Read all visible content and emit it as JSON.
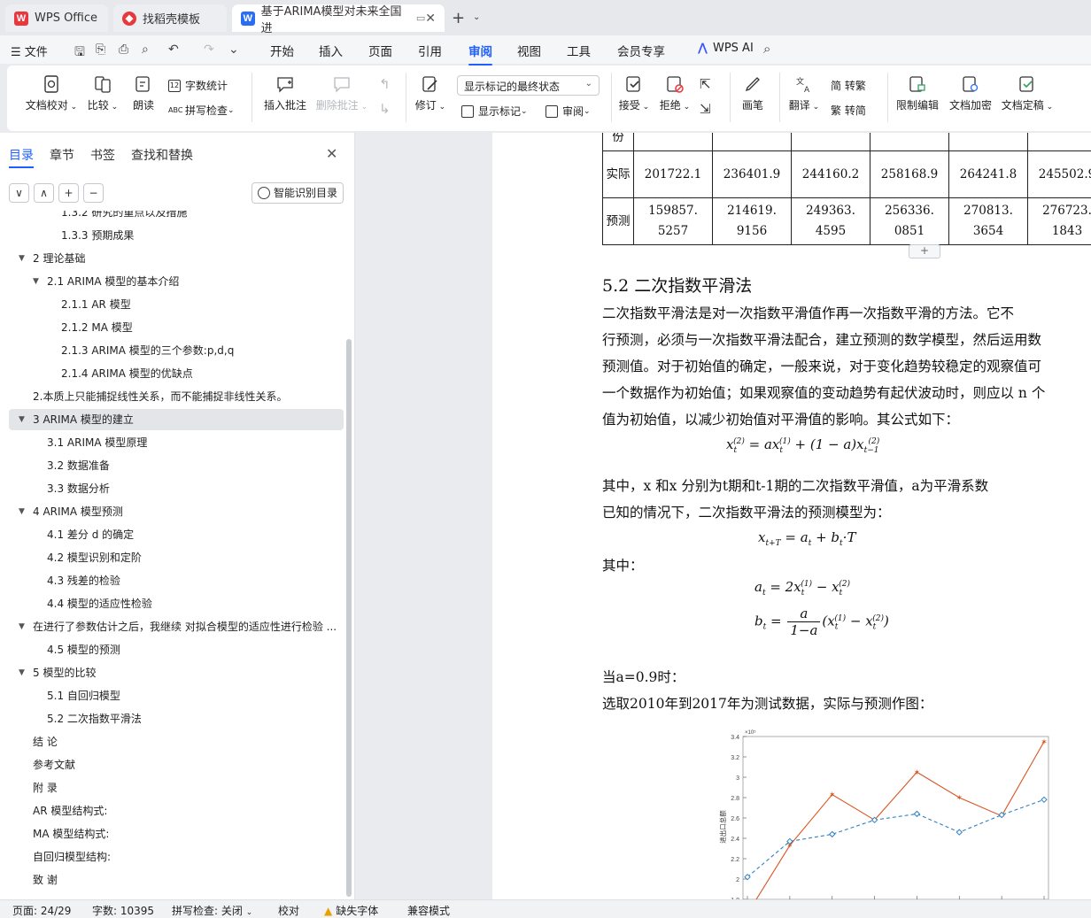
{
  "tabs": {
    "wps_office": "WPS Office",
    "templates": "找稻壳模板",
    "document": "基于ARIMA模型对未来全国进"
  },
  "menubar": {
    "file": "文件",
    "tabs": [
      "开始",
      "插入",
      "页面",
      "引用",
      "审阅",
      "视图",
      "工具",
      "会员专享"
    ],
    "active_tab": "审阅",
    "wps_ai": "WPS AI"
  },
  "ribbon": {
    "proofread": "文档校对",
    "compare": "比较",
    "read_aloud": "朗读",
    "word_count": "字数统计",
    "spell_check": "拼写检查",
    "insert_comment": "插入批注",
    "delete_comment": "删除批注",
    "track_changes": "修订",
    "markup_view": "显示标记的最终状态",
    "show_markup": "显示标记",
    "review": "审阅",
    "accept": "接受",
    "reject": "拒绝",
    "ink": "画笔",
    "translate": "翻译",
    "to_traditional": "简 转繁",
    "to_simplified": "繁 转简",
    "restrict_edit": "限制编辑",
    "encrypt": "文档加密",
    "finalize": "文档定稿"
  },
  "nav": {
    "tabs": [
      "目录",
      "章节",
      "书签",
      "查找和替换"
    ],
    "active_tab": "目录",
    "smart_toc": "智能识别目录",
    "buttons": [
      "∨",
      "∧",
      "+",
      "−"
    ],
    "toc": [
      {
        "text": "1.3.2 研究的重点以及措施",
        "level": 3,
        "arrow": false
      },
      {
        "text": "1.3.3 预期成果",
        "level": 3,
        "arrow": false
      },
      {
        "text": "2   理论基础",
        "level": 1,
        "arrow": true
      },
      {
        "text": "2.1 ARIMA 模型的基本介绍",
        "level": 2,
        "arrow": true
      },
      {
        "text": "2.1.1 AR 模型",
        "level": 3,
        "arrow": false
      },
      {
        "text": "2.1.2    MA 模型",
        "level": 3,
        "arrow": false
      },
      {
        "text": "2.1.3    ARIMA 模型的三个参数:p,d,q",
        "level": 3,
        "arrow": false
      },
      {
        "text": "2.1.4    ARIMA 模型的优缺点",
        "level": 3,
        "arrow": false
      },
      {
        "text": "2.本质上只能捕捉线性关系，而不能捕捉非线性关系。",
        "level": 1,
        "arrow": false
      },
      {
        "text": "3 ARIMA 模型的建立",
        "level": 1,
        "arrow": true,
        "selected": true
      },
      {
        "text": "3.1 ARIMA 模型原理",
        "level": 2,
        "arrow": false
      },
      {
        "text": "3.2  数据准备",
        "level": 2,
        "arrow": false
      },
      {
        "text": "3.3  数据分析",
        "level": 2,
        "arrow": false
      },
      {
        "text": "4 ARIMA 模型预测",
        "level": 1,
        "arrow": true
      },
      {
        "text": "4.1  差分 d 的确定",
        "level": 2,
        "arrow": false
      },
      {
        "text": "4.2 模型识别和定阶",
        "level": 2,
        "arrow": false
      },
      {
        "text": "4.3  残差的检验",
        "level": 2,
        "arrow": false
      },
      {
        "text": "4.4 模型的适应性检验",
        "level": 2,
        "arrow": false
      },
      {
        "text": "在进行了参数估计之后，我继续  对拟合模型的适应性进行检验 ...",
        "level": 1,
        "arrow": true
      },
      {
        "text": "4.5 模型的预测",
        "level": 2,
        "arrow": false
      },
      {
        "text": "5  模型的比较",
        "level": 1,
        "arrow": true
      },
      {
        "text": "5.1 自回归模型",
        "level": 2,
        "arrow": false
      },
      {
        "text": "5.2 二次指数平滑法",
        "level": 2,
        "arrow": false
      },
      {
        "text": "结  论",
        "level": 1,
        "arrow": false
      },
      {
        "text": "参考文献",
        "level": 1,
        "arrow": false
      },
      {
        "text": "附  录",
        "level": 1,
        "arrow": false
      },
      {
        "text": "AR 模型结构式:",
        "level": 1,
        "arrow": false
      },
      {
        "text": "MA 模型结构式:",
        "level": 1,
        "arrow": false
      },
      {
        "text": "自回归模型结构:",
        "level": 1,
        "arrow": false
      },
      {
        "text": "致  谢",
        "level": 1,
        "arrow": false
      }
    ]
  },
  "document": {
    "table": {
      "header_row": [
        "份",
        "",
        "",
        "",
        "",
        "",
        ""
      ],
      "actual_label": "实际",
      "actual": [
        "201722.1",
        "236401.9",
        "244160.2",
        "258168.9",
        "264241.8",
        "245502.9"
      ],
      "pred_label": "预测",
      "pred_line1": [
        "159857.",
        "214619.",
        "249363.",
        "256336.",
        "270813.",
        "276723."
      ],
      "pred_line2": [
        "5257",
        "9156",
        "4595",
        "0851",
        "3654",
        "1843"
      ]
    },
    "heading": "5.2 二次指数平滑法",
    "paragraph1": [
      "        二次指数平滑法是对一次指数平滑值作再一次指数平滑的方法。它不",
      "行预测，必须与一次指数平滑法配合，建立预测的数学模型，然后运用数",
      "预测值。对于初始值的确定，一般来说，对于变化趋势较稳定的观察值可",
      "一个数据作为初始值；如果观察值的变动趋势有起伏波动时，则应以 n 个",
      "值为初始值，以减少初始值对平滑值的影响。其公式如下："
    ],
    "formula1": "x_t^(2) = a x_t^(1) + (1 − a) x_{t−1}^(2)",
    "paragraph2_line1": "        其中，x  和x   分别为t期和t-1期的二次指数平滑值，a为平滑系数",
    "paragraph2_line2": "已知的情况下，二次指数平滑法的预测模型为：",
    "where_label": "        其中：",
    "when_label": "        当a=0.9时：",
    "select_label": "        选取2010年到2017年为测试数据，实际与预测作图："
  },
  "chart_data": {
    "type": "line",
    "title": "",
    "xlabel": "",
    "ylabel": "进出口总额",
    "y_exponent_label": "×10⁵",
    "ylim": [
      1.8,
      3.4
    ],
    "yticks": [
      "1.8",
      "2",
      "2.2",
      "2.4",
      "2.6",
      "2.8",
      "3",
      "3.2",
      "3.4"
    ],
    "x": [
      1,
      2,
      3,
      4,
      5,
      6,
      7,
      8
    ],
    "series": [
      {
        "values": [
          1.66,
          2.33,
          2.83,
          2.58,
          3.05,
          2.8,
          2.62,
          3.35
        ],
        "color": "#d9541f",
        "marker": "star",
        "dash": false
      },
      {
        "values": [
          2.02,
          2.37,
          2.44,
          2.58,
          2.64,
          2.46,
          2.63,
          2.78
        ],
        "color": "#2f7fc1",
        "marker": "diamond",
        "dash": true
      }
    ]
  },
  "status": {
    "page": "页面: 24/29",
    "words": "字数: 10395",
    "spell": "拼写检查: 关闭",
    "proof": "校对",
    "missing_font": "缺失字体",
    "compat": "兼容模式"
  }
}
